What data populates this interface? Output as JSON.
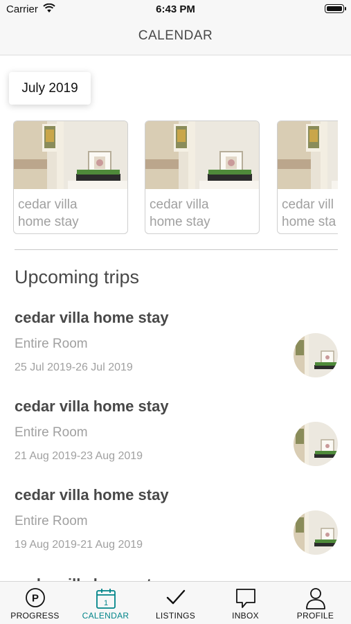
{
  "status_bar": {
    "carrier": "Carrier",
    "time": "6:43 PM"
  },
  "nav": {
    "title": "CALENDAR"
  },
  "month_selector": {
    "label": "July 2019"
  },
  "cards": [
    {
      "line1": "cedar villa",
      "line2": "home stay"
    },
    {
      "line1": "cedar villa",
      "line2": "home stay"
    },
    {
      "line1": "cedar vill",
      "line2": "home sta"
    }
  ],
  "upcoming": {
    "title": "Upcoming trips",
    "trips": [
      {
        "name": "cedar villa home stay",
        "type": "Entire Room",
        "dates": "25 Jul 2019-26 Jul 2019"
      },
      {
        "name": "cedar villa home stay",
        "type": "Entire Room",
        "dates": "21 Aug 2019-23 Aug 2019"
      },
      {
        "name": "cedar villa home stay",
        "type": "Entire Room",
        "dates": "19 Aug 2019-21 Aug 2019"
      }
    ],
    "partial_trip_name": "cedar villa home stay"
  },
  "tabbar": {
    "active": "CALENDAR",
    "accent_color": "#008489",
    "calendar_icon_day": "1",
    "tabs": [
      {
        "label": "PROGRESS",
        "icon": "progress-p-icon"
      },
      {
        "label": "CALENDAR",
        "icon": "calendar-icon"
      },
      {
        "label": "LISTINGS",
        "icon": "checkmark-icon"
      },
      {
        "label": "INBOX",
        "icon": "chat-bubble-icon"
      },
      {
        "label": "PROFILE",
        "icon": "person-icon"
      }
    ]
  }
}
